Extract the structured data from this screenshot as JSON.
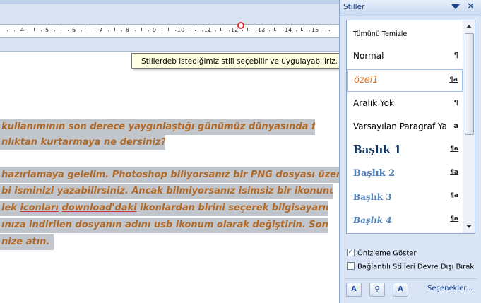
{
  "ruler": {
    "numbers": [
      "4",
      "5",
      "6",
      "7",
      "8",
      "9",
      "10",
      "11",
      "12",
      "13",
      "14",
      "15"
    ]
  },
  "document": {
    "lines": [
      {
        "text": "kullanımının son derece yaygınlaştığı günümüz dünyasında flash"
      },
      {
        "text": "nlıktan kurtarmaya ne dersiniz?"
      },
      {
        "text": "hazırlamaya gelelim. Photoshop biliyorsanız bir PNG dosyası üzerine"
      },
      {
        "text": "bi isminizi yazabilirsiniz. Ancak bilmiyorsanız isimsiz bir ikonunuz"
      },
      {
        "pre": "lek ",
        "link1": "iconları",
        "mid": " ",
        "link2": "download'daki",
        "post": " ikonlardan birini seçerek bilgisayarınıza"
      },
      {
        "text": "ınıza indirilen dosyanın adını usb ikonum olarak değiştirin. Sonra"
      },
      {
        "text": "nize atın."
      }
    ]
  },
  "tooltip": {
    "text": "Stillerdeb istediğimiz stili seçebilir ve uygulayabiliriz."
  },
  "panel": {
    "title": "Stiller",
    "items": [
      {
        "label": "Tümünü Temizle",
        "mark": ""
      },
      {
        "label": "Normal",
        "mark": "¶"
      },
      {
        "label": "özel1",
        "mark": "¶a"
      },
      {
        "label": "Aralık Yok",
        "mark": "¶"
      },
      {
        "label": "Varsayılan Paragraf Ya",
        "mark": "a"
      },
      {
        "label": "Başlık 1",
        "mark": "¶a"
      },
      {
        "label": "Başlık 2",
        "mark": "¶a"
      },
      {
        "label": "Başlık 3",
        "mark": "¶a"
      },
      {
        "label": "Başlık 4",
        "mark": "¶a"
      }
    ],
    "preview_label": "Önizleme Göster",
    "preview_checked": true,
    "linked_label": "Bağlantılı Stilleri Devre Dışı Bırak",
    "linked_checked": false,
    "options_label": "Seçenekler..."
  },
  "colors": {
    "accent_red": "#e01818",
    "highlight": "#c0c6cc",
    "doc_text": "#b06a2a",
    "style_orange": "#e07020",
    "heading_blue": "#4f81bd"
  }
}
